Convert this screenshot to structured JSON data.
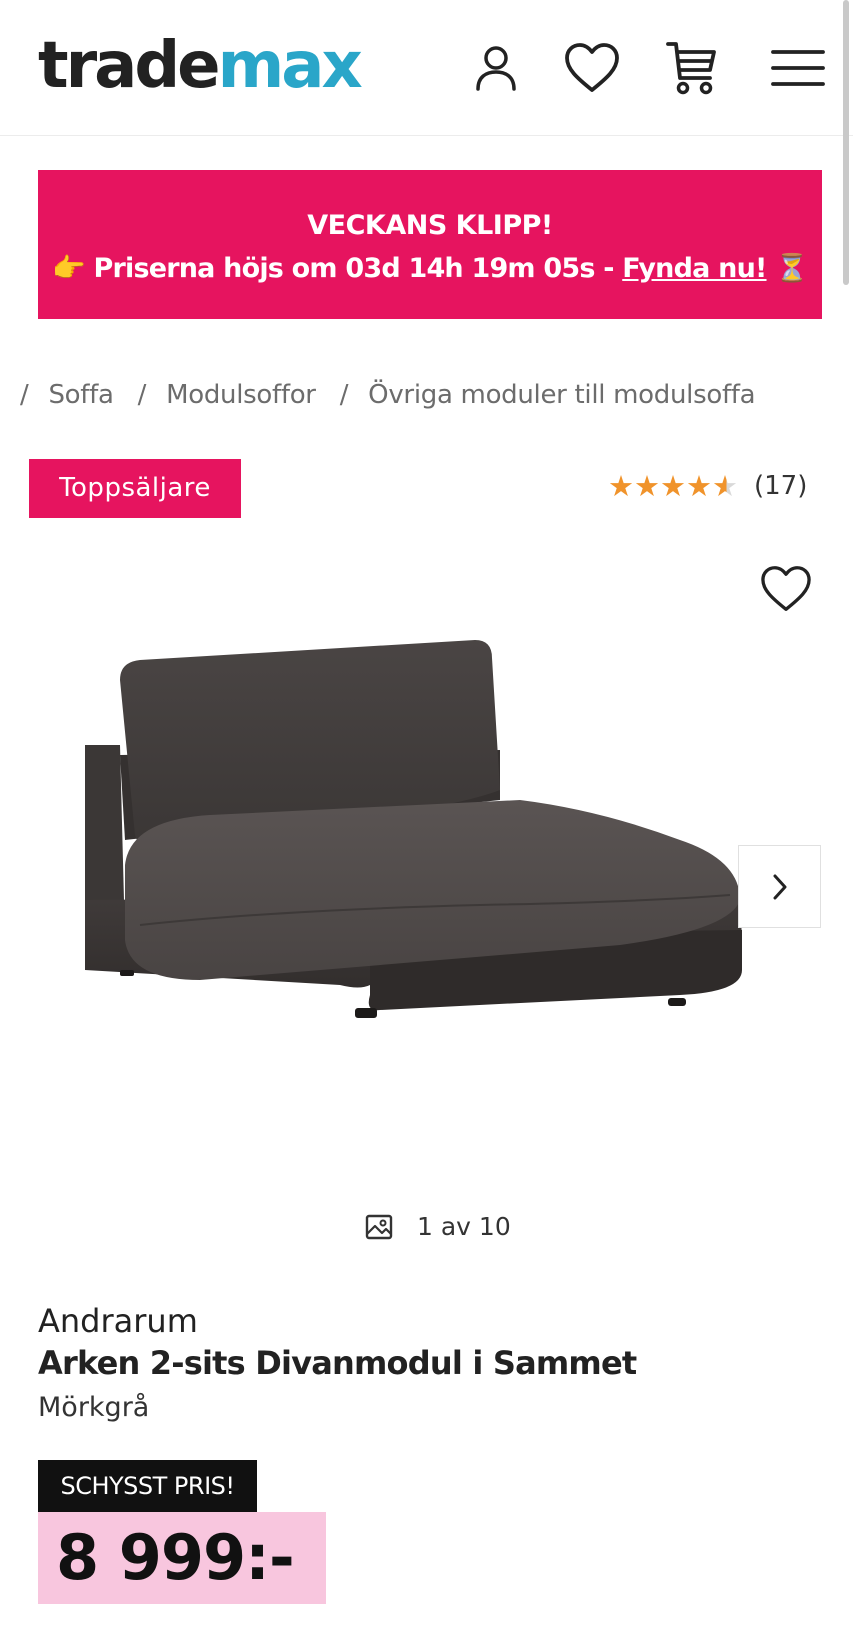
{
  "header": {
    "logo_part1": "trade",
    "logo_part2": "max",
    "icons": [
      "user-icon",
      "heart-icon",
      "cart-icon",
      "menu-icon"
    ]
  },
  "promo": {
    "title": "VECKANS KLIPP!",
    "emoji_left": "👉",
    "text": "Priserna höjs om 03d 14h 19m 05s - ",
    "link": "Fynda nu!",
    "emoji_right": "⏳",
    "bg_color": "#e6145f"
  },
  "breadcrumb": {
    "separator": "/",
    "items": [
      "Soffa",
      "Modulsoffor",
      "Övriga moduler till modulsoffa"
    ]
  },
  "product": {
    "badge": "Toppsäljare",
    "rating": {
      "value": 4.5,
      "max": 5,
      "count": "(17)"
    },
    "image_counter": "1 av 10",
    "brand": "Andrarum",
    "name": "Arken 2-sits Divanmodul i Sammet",
    "color": "Mörkgrå",
    "price_badge": "SCHYSST PRIS!",
    "price": "8 999:-",
    "price_bg": "#f8c6de"
  }
}
